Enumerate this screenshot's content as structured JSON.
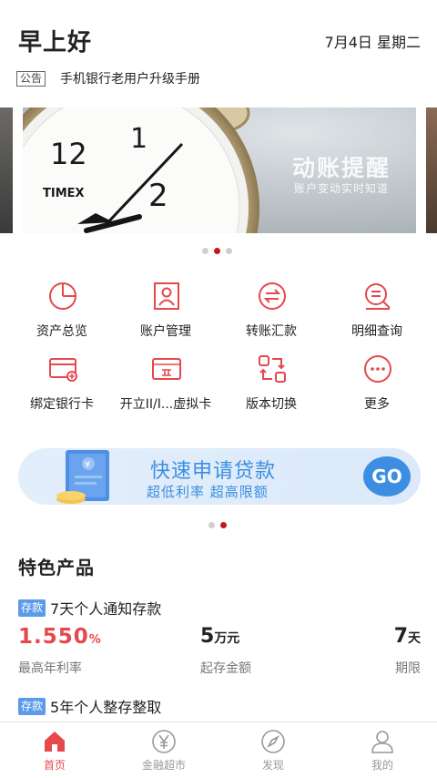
{
  "header": {
    "greeting": "早上好",
    "date": "7月4日 星期二"
  },
  "notice": {
    "tag": "公告",
    "text": "手机银行老用户升级手册"
  },
  "banner": {
    "title": "动账提醒",
    "subtitle": "账户变动实时知道",
    "clock_brand": "TIMEX",
    "clock_numbers": [
      "12",
      "1",
      "2"
    ],
    "page_count": 3,
    "active_page": 2
  },
  "grid": [
    {
      "label": "资产总览",
      "icon": "pie-chart-icon"
    },
    {
      "label": "账户管理",
      "icon": "account-card-icon"
    },
    {
      "label": "转账汇款",
      "icon": "transfer-icon"
    },
    {
      "label": "明细查询",
      "icon": "detail-search-icon"
    },
    {
      "label": "绑定银行卡",
      "icon": "bind-card-icon"
    },
    {
      "label": "开立II/I...虚拟卡",
      "icon": "virtual-card-icon"
    },
    {
      "label": "版本切换",
      "icon": "version-switch-icon"
    },
    {
      "label": "更多",
      "icon": "more-icon"
    }
  ],
  "loan": {
    "title": "快速申请贷款",
    "subtitle": "超低利率 超高限额",
    "go": "GO",
    "doc_symbol": "¥",
    "page_count": 2,
    "active_page": 2
  },
  "featured": {
    "title": "特色产品",
    "products": [
      {
        "badge": "存款",
        "name": "7天个人通知存款",
        "rate": "1.550",
        "rate_unit": "%",
        "rate_label": "最高年利率",
        "min_amount": "5",
        "min_unit": "万元",
        "min_label": "起存金额",
        "term": "7",
        "term_unit": "天",
        "term_label": "期限"
      },
      {
        "badge": "存款",
        "name": "5年个人整存整取"
      }
    ]
  },
  "tabbar": [
    {
      "label": "首页",
      "icon": "home-icon",
      "active": true
    },
    {
      "label": "金融超市",
      "icon": "yuan-icon",
      "active": false
    },
    {
      "label": "发现",
      "icon": "compass-icon",
      "active": false
    },
    {
      "label": "我的",
      "icon": "user-icon",
      "active": false
    }
  ],
  "colors": {
    "accent": "#e5484d",
    "dot_active": "#c0191e",
    "loan_blue": "#3c8ee3",
    "badge_blue": "#5b9bea"
  }
}
